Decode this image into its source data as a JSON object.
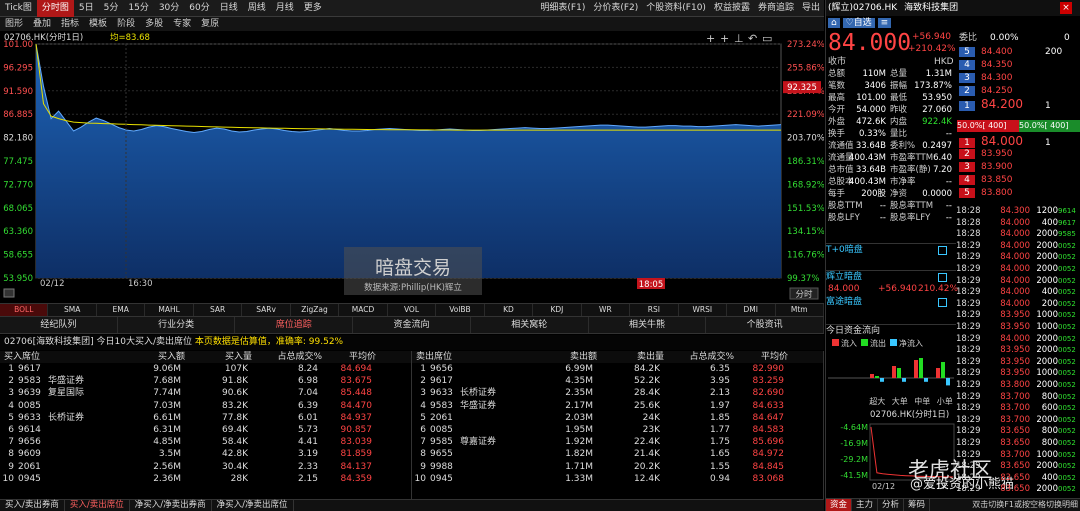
{
  "period_tabs": [
    "Tick图",
    "分时图",
    "5日",
    "5分",
    "15分",
    "30分",
    "60分",
    "日线",
    "周线",
    "月线",
    "更多"
  ],
  "active_period": "分时图",
  "right_tools": [
    "明细表(F1)",
    "分价表(F2)",
    "个股资料(F10)",
    "权益披露",
    "券商追踪",
    "导出"
  ],
  "toolbar2": [
    "图形",
    "叠加",
    "指标",
    "模板",
    "阶段",
    "多股",
    "专家",
    "复原"
  ],
  "chart": {
    "header_code": "02706.HK(分时1日)",
    "avg_label": "均=83.68",
    "price_ticks": [
      "101.00",
      "96.295",
      "91.590",
      "86.885",
      "82.180",
      "77.475",
      "72.770",
      "68.065",
      "63.360",
      "58.655",
      "53.950"
    ],
    "pct_ticks": [
      "273.24%",
      "255.86%",
      "238.47%",
      "221.09%",
      "203.70%",
      "186.31%",
      "168.92%",
      "151.53%",
      "134.15%",
      "116.76%",
      "99.37%"
    ],
    "price_range": [
      53.95,
      101.0
    ],
    "time_start": "02/12",
    "time_mid": "16:30",
    "time_label": "18:05",
    "cursor_price": "92.325",
    "watermark_title": "暗盘交易",
    "watermark_sub": "数据来源:Phillip(HK)辉立",
    "fenshi_btn": "分时",
    "price_series": [
      101,
      92.5,
      86,
      87.5,
      85.5,
      83.5,
      84.3,
      85.3,
      86.1,
      85.6,
      84.9,
      84.2,
      83.7,
      83.5,
      83.8,
      84.3,
      84.6,
      84.4,
      84.0,
      83.7,
      83.4,
      83.2,
      83.4,
      83.8,
      84.1,
      83.9,
      83.5,
      83.3,
      83.4,
      83.7,
      83.9,
      84.1,
      83.9,
      83.6,
      83.4,
      83.3,
      83.4,
      83.6,
      83.8,
      84.0,
      83.8,
      83.6,
      83.5,
      83.5,
      83.6,
      83.8,
      83.9,
      84.0,
      83.9,
      83.8,
      83.7,
      83.6,
      83.6,
      83.7,
      83.8,
      83.9,
      83.8,
      83.7,
      83.6,
      83.6,
      83.7,
      83.8,
      83.9,
      84.0,
      84.1,
      84.2,
      84.1,
      84.0,
      84.0,
      84.1,
      84.2,
      84.3,
      84.4,
      84.5,
      84.6,
      84.7,
      84.7,
      84.6,
      84.5,
      84.4,
      84.3,
      84.3,
      84.4,
      84.5,
      84.6,
      84.6,
      84.5,
      84.5,
      84.4,
      84.4,
      84.5,
      84.6,
      84.7,
      84.8,
      84.7,
      84.6,
      84.5,
      84.6,
      84.7,
      84.8
    ],
    "avg_series": [
      101,
      89,
      86.5,
      86.0,
      85.6,
      85.3,
      85.2,
      85.1,
      85.05,
      85.0,
      84.95,
      84.9,
      84.85,
      84.8,
      84.75,
      84.7,
      84.66,
      84.62,
      84.58,
      84.54,
      84.5,
      84.46,
      84.42,
      84.38,
      84.34,
      84.3,
      84.26,
      84.22,
      84.19,
      84.16,
      84.13,
      84.1,
      84.07,
      84.04,
      84.01,
      83.98,
      83.96,
      83.94,
      83.92,
      83.9,
      83.88,
      83.86,
      83.84,
      83.82,
      83.8,
      83.79,
      83.78,
      83.77,
      83.76,
      83.75,
      83.74,
      83.73,
      83.72,
      83.71,
      83.7,
      83.7,
      83.69,
      83.69,
      83.68,
      83.68,
      83.68,
      83.68,
      83.68,
      83.68,
      83.68,
      83.68,
      83.68,
      83.68,
      83.68,
      83.68,
      83.68,
      83.68,
      83.68,
      83.68,
      83.68,
      83.68,
      83.68,
      83.68,
      83.68,
      83.68,
      83.68,
      83.68,
      83.68,
      83.68,
      83.68,
      83.68,
      83.68,
      83.68,
      83.68,
      83.68,
      83.68,
      83.68,
      83.68,
      83.68,
      83.68,
      83.68,
      83.68,
      83.68,
      83.68,
      83.68
    ]
  },
  "indicators": [
    "BOLL",
    "SMA",
    "EMA",
    "MAHL",
    "SAR",
    "SARv",
    "ZigZag",
    "MACD",
    "VOL",
    "VolBB",
    "KD",
    "KDJ",
    "WR",
    "RSI",
    "WRSI",
    "DMI",
    "Mtm"
  ],
  "tabs2": [
    "经纪队列",
    "行业分类",
    "席位追踪",
    "资金流向",
    "相关窝轮",
    "相关牛熊",
    "个股资讯"
  ],
  "active_tab2": "席位追踪",
  "info": {
    "prefix": "02706[海致科技集团] 今日10大买入/卖出席位",
    "notice": "本页数据是估算值，准确率:",
    "rate": "99.52%"
  },
  "buy_table": {
    "headers": [
      "买入席位",
      "买入额",
      "买入量",
      "占总成交%",
      "平均价"
    ],
    "rows": [
      [
        "1",
        "9617",
        "",
        "9.06M",
        "107K",
        "8.24",
        "84.694"
      ],
      [
        "2",
        "9583",
        "华盛证券",
        "7.68M",
        "91.8K",
        "6.98",
        "83.675"
      ],
      [
        "3",
        "9639",
        "复星国际",
        "7.74M",
        "90.6K",
        "7.04",
        "85.448"
      ],
      [
        "4",
        "0085",
        "",
        "7.03M",
        "83.2K",
        "6.39",
        "84.470"
      ],
      [
        "5",
        "9633",
        "长桥证券",
        "6.61M",
        "77.8K",
        "6.01",
        "84.937"
      ],
      [
        "6",
        "9614",
        "",
        "6.31M",
        "69.4K",
        "5.73",
        "90.857"
      ],
      [
        "7",
        "9656",
        "",
        "4.85M",
        "58.4K",
        "4.41",
        "83.039"
      ],
      [
        "8",
        "9609",
        "",
        "3.5M",
        "42.8K",
        "3.19",
        "81.859"
      ],
      [
        "9",
        "2061",
        "",
        "2.56M",
        "30.4K",
        "2.33",
        "84.137"
      ],
      [
        "10",
        "0945",
        "",
        "2.36M",
        "28K",
        "2.15",
        "84.359"
      ]
    ]
  },
  "sell_table": {
    "headers": [
      "卖出席位",
      "卖出额",
      "卖出量",
      "占总成交%",
      "平均价"
    ],
    "rows": [
      [
        "1",
        "9656",
        "",
        "6.99M",
        "84.2K",
        "6.35",
        "82.990"
      ],
      [
        "2",
        "9617",
        "",
        "4.35M",
        "52.2K",
        "3.95",
        "83.259"
      ],
      [
        "3",
        "9633",
        "长桥证券",
        "2.35M",
        "28.4K",
        "2.13",
        "82.690"
      ],
      [
        "4",
        "9583",
        "华盛证券",
        "2.17M",
        "25.6K",
        "1.97",
        "84.633"
      ],
      [
        "5",
        "2061",
        "",
        "2.03M",
        "24K",
        "1.85",
        "84.647"
      ],
      [
        "6",
        "0085",
        "",
        "1.95M",
        "23K",
        "1.77",
        "84.583"
      ],
      [
        "7",
        "9585",
        "尊嘉证券",
        "1.92M",
        "22.4K",
        "1.75",
        "85.696"
      ],
      [
        "8",
        "9655",
        "",
        "1.82M",
        "21.4K",
        "1.65",
        "84.972"
      ],
      [
        "9",
        "9988",
        "",
        "1.71M",
        "20.2K",
        "1.55",
        "84.845"
      ],
      [
        "10",
        "0945",
        "",
        "1.33M",
        "12.4K",
        "0.94",
        "83.068"
      ]
    ]
  },
  "bottom_tabs": [
    "买入/卖出券商",
    "买入/卖出席位",
    "净买入/净卖出券商",
    "净买入/净卖出席位"
  ],
  "active_bottom": "买入/卖出席位",
  "right": {
    "tag": "(辉立)",
    "code": "02706.HK",
    "name": "海致科技集团",
    "fav": "自选",
    "price": "84.000",
    "change": "+56.940",
    "change_pct": "+210.42%",
    "currency": "HKD",
    "close_label": "收市",
    "ratio_label": "委比",
    "ratio_value": "0.00%",
    "ratio_vol": "0",
    "ask": [
      [
        "5",
        "84.400",
        "200"
      ],
      [
        "4",
        "84.350",
        ""
      ],
      [
        "3",
        "84.300",
        ""
      ],
      [
        "2",
        "84.250",
        ""
      ],
      [
        "1",
        "84.200",
        "1"
      ]
    ],
    "bid": [
      [
        "1",
        "84.000",
        "1"
      ],
      [
        "2",
        "83.950",
        ""
      ],
      [
        "3",
        "83.900",
        ""
      ],
      [
        "4",
        "83.850",
        ""
      ],
      [
        "5",
        "83.800",
        ""
      ]
    ],
    "bar_left": "50.0%[ 400]",
    "bar_right": "50.0%[ 400]",
    "quote": [
      [
        "总额",
        "110M",
        "总量",
        "1.31M"
      ],
      [
        "笔数",
        "3406",
        "振幅",
        "173.87%"
      ],
      [
        "最高",
        "101.00",
        "最低",
        "53.950"
      ],
      [
        "今开",
        "54.000",
        "昨收",
        "27.060"
      ],
      [
        "外盘",
        "472.6K",
        "内盘",
        "922.4K"
      ],
      [
        "换手",
        "0.33%",
        "量比",
        "--"
      ],
      [
        "流通值",
        "33.64B",
        "委利%",
        "0.2497"
      ],
      [
        "流通量",
        "400.43M",
        "市盈率TTM",
        "6.40"
      ],
      [
        "总市值",
        "33.64B",
        "市盈率(静)",
        "7.20"
      ],
      [
        "总股本",
        "400.43M",
        "市净率",
        "--"
      ],
      [
        "每手",
        "200股",
        "净资",
        "0.0000"
      ],
      [
        "股息TTM",
        "--",
        "股息率TTM",
        "--"
      ],
      [
        "股息LFY",
        "--",
        "股息率LFY",
        "--"
      ]
    ],
    "dark_title": "T+0暗盘",
    "phillip_title": "辉立暗盘",
    "phillip_price": "84.000",
    "phillip_change": "+56.940",
    "phillip_pct": "210.42%",
    "futu_title": "富途暗盘",
    "flow_title": "今日资金流向",
    "flow_legend": [
      "流入",
      "流出",
      "净流入"
    ],
    "flow_axis": [
      "超大",
      "大单",
      "中单",
      "小单"
    ],
    "flow_inflow": [
      0.2,
      0.6,
      0.9,
      0.5
    ],
    "flow_outflow": [
      0.1,
      0.5,
      1.0,
      0.8
    ],
    "mini_chart_title": "02706.HK(分时1日)",
    "mini_axis": [
      "-4.64M",
      "-16.9M",
      "-29.2M",
      "-41.5M"
    ],
    "mini_time": [
      "02/12",
      "17:"
    ],
    "mini_series": [
      0.02,
      0.9,
      0.92,
      0.93,
      0.94,
      0.95,
      0.955,
      0.96,
      0.965,
      0.97,
      0.972,
      0.974,
      0.976,
      0.978,
      0.98
    ],
    "bottom_tabs": [
      "资金",
      "主力",
      "分析",
      "筹码"
    ],
    "bottom_right": "双击切换F1或按空格切换明细",
    "watermark1": "老虎社区",
    "watermark2": "@爱投资的小熊猫",
    "trades": [
      [
        "18:28",
        "84.300",
        "1200",
        "9614"
      ],
      [
        "18:28",
        "84.000",
        "400",
        "9617"
      ],
      [
        "18:28",
        "84.000",
        "2000",
        "9585"
      ],
      [
        "18:29",
        "84.000",
        "2000",
        "0052"
      ],
      [
        "18:29",
        "84.000",
        "2000",
        "0052"
      ],
      [
        "18:29",
        "84.000",
        "2000",
        "0052"
      ],
      [
        "18:29",
        "84.000",
        "2000",
        "0052"
      ],
      [
        "18:29",
        "84.000",
        "400",
        "0052"
      ],
      [
        "18:29",
        "84.000",
        "200",
        "0052"
      ],
      [
        "18:29",
        "83.950",
        "1000",
        "0052"
      ],
      [
        "18:29",
        "83.950",
        "1000",
        "0052"
      ],
      [
        "18:29",
        "84.000",
        "2000",
        "0052"
      ],
      [
        "18:29",
        "83.950",
        "2000",
        "0052"
      ],
      [
        "18:29",
        "83.950",
        "2000",
        "0052"
      ],
      [
        "18:29",
        "83.950",
        "1000",
        "0052"
      ],
      [
        "18:29",
        "83.800",
        "2000",
        "0052"
      ],
      [
        "18:29",
        "83.700",
        "800",
        "0052"
      ],
      [
        "18:29",
        "83.700",
        "600",
        "0052"
      ],
      [
        "18:29",
        "83.700",
        "2000",
        "0052"
      ],
      [
        "18:29",
        "83.650",
        "800",
        "0052"
      ],
      [
        "18:29",
        "83.650",
        "800",
        "0052"
      ],
      [
        "18:29",
        "83.700",
        "1000",
        "0052"
      ],
      [
        "18:29",
        "83.650",
        "2000",
        "0052"
      ],
      [
        "18:29",
        "83.650",
        "400",
        "0052"
      ],
      [
        "18:29",
        "83.650",
        "2000",
        "0052"
      ]
    ]
  }
}
